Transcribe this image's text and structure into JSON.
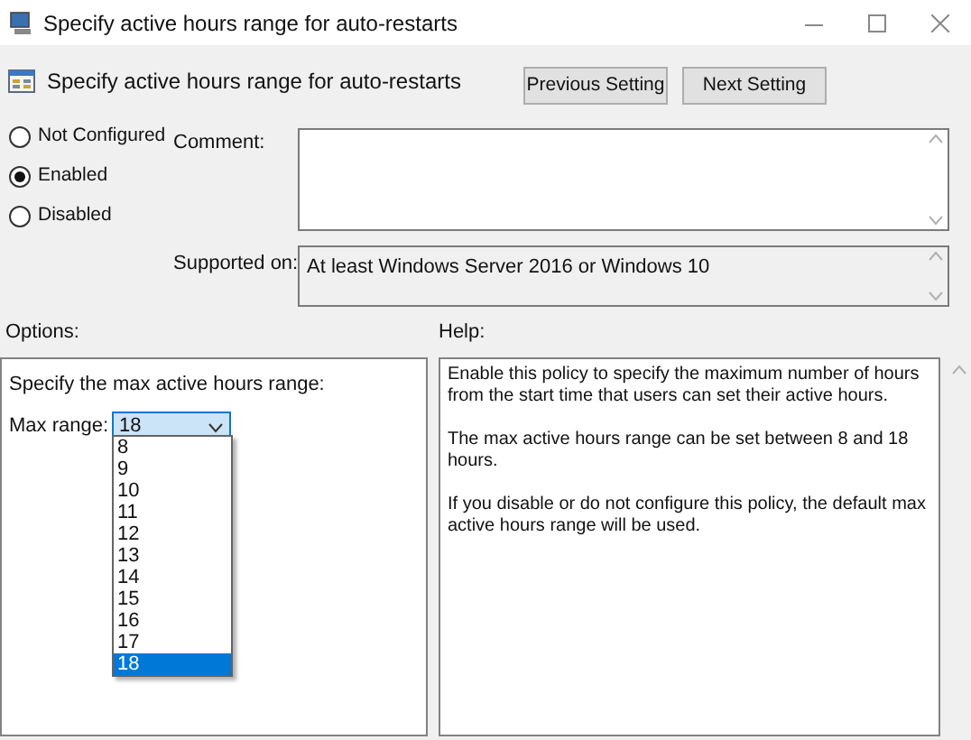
{
  "window": {
    "title": "Specify active hours range for auto-restarts"
  },
  "header": {
    "title": "Specify active hours range for auto-restarts"
  },
  "nav_buttons": [
    {
      "label": "Previous Setting"
    },
    {
      "label": "Next Setting"
    }
  ],
  "state_options": [
    {
      "label": "Not Configured",
      "selected": false
    },
    {
      "label": "Enabled",
      "selected": true
    },
    {
      "label": "Disabled",
      "selected": false
    }
  ],
  "comment": {
    "label": "Comment:"
  },
  "supported_on": {
    "label": "Supported on:",
    "value": "At least Windows Server 2016 or Windows 10"
  },
  "options": {
    "label": "Options:",
    "prompt": "Specify the max active hours range:",
    "field_label": "Max range:",
    "value": "18",
    "dropdown_items": [
      {
        "label": "8",
        "selected": false
      },
      {
        "label": "9",
        "selected": false
      },
      {
        "label": "10",
        "selected": false
      },
      {
        "label": "11",
        "selected": false
      },
      {
        "label": "12",
        "selected": false
      },
      {
        "label": "13",
        "selected": false
      },
      {
        "label": "14",
        "selected": false
      },
      {
        "label": "15",
        "selected": false
      },
      {
        "label": "16",
        "selected": false
      },
      {
        "label": "17",
        "selected": false
      },
      {
        "label": "18",
        "selected": true
      }
    ]
  },
  "help": {
    "label": "Help:",
    "paragraphs": [
      "Enable this policy to specify the maximum number of hours from the start time that users can set their active hours.",
      "The max active hours range can be set between 8 and 18 hours.",
      "If you disable or do not configure this policy, the default max active hours range will be used."
    ]
  }
}
